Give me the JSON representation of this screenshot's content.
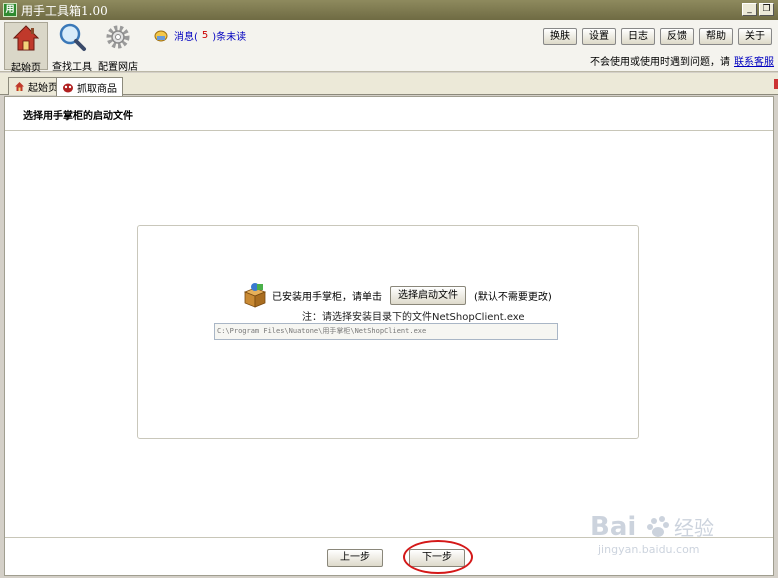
{
  "window": {
    "title": "用手工具箱1.00",
    "logo_char": "用",
    "minimize": "_",
    "restore": "❐"
  },
  "toolbar": {
    "tools": [
      {
        "label": "起始页",
        "icon": "home-icon"
      },
      {
        "label": "查找工具",
        "icon": "search-icon"
      },
      {
        "label": "配置网店",
        "icon": "gear-icon"
      }
    ],
    "message": {
      "prefix": "消息(",
      "count": "5",
      "suffix": ")条未读"
    },
    "buttons": [
      "换肤",
      "设置",
      "日志",
      "反馈",
      "帮助",
      "关于"
    ],
    "help_text": "不会使用或使用时遇到问题，请",
    "help_link": "联系客服"
  },
  "tabs": [
    {
      "label": "起始页",
      "icon": "home-icon"
    },
    {
      "label": "抓取商品",
      "icon": "bug-icon"
    }
  ],
  "content": {
    "section_title": "选择用手掌柜的启动文件",
    "installed_text": "已安装用手掌柜，请单击",
    "pick_button": "选择启动文件",
    "default_hint": "(默认不需要更改)",
    "note": "注：请选择安装目录下的文件NetShopClient.exe",
    "path_value": "C:\\Program Files\\Nuatone\\用手掌柜\\NetShopClient.exe",
    "prev_button": "上一步",
    "next_button": "下一步"
  },
  "watermark": {
    "brand": "Bai",
    "brand2": "经验",
    "url": "jingyan.baidu.com"
  }
}
